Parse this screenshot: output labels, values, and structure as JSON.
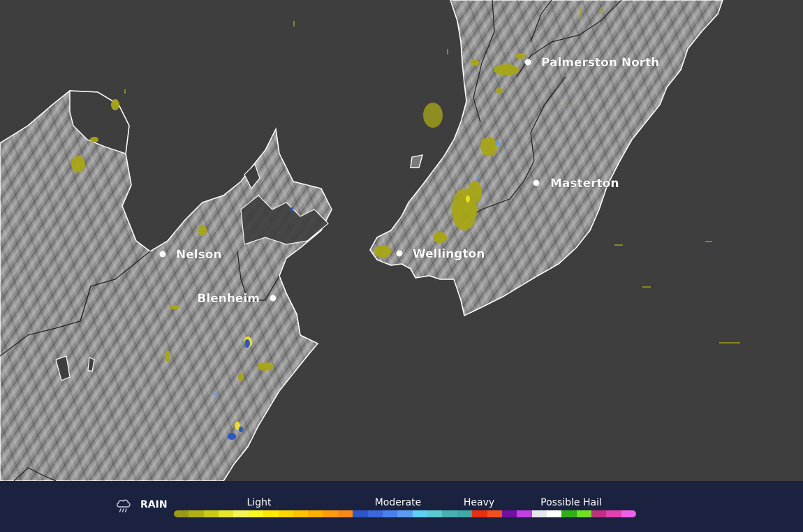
{
  "map": {
    "cities": [
      {
        "name": "Palmerston North"
      },
      {
        "name": "Masterton"
      },
      {
        "name": "Nelson"
      },
      {
        "name": "Wellington"
      },
      {
        "name": "Blenheim"
      }
    ]
  },
  "legend": {
    "icon": "rain-cloud-icon",
    "title": "RAIN",
    "labels": {
      "light": "Light",
      "moderate": "Moderate",
      "heavy": "Heavy",
      "hail": "Possible Hail"
    },
    "swatches": [
      "#9a9a12",
      "#b0b012",
      "#caca14",
      "#e6e628",
      "#f4f454",
      "#f8f820",
      "#fce800",
      "#fcd600",
      "#fcc400",
      "#fcb000",
      "#fb9c0a",
      "#f88a14",
      "#2d56c8",
      "#3c68dc",
      "#4a80ec",
      "#5a9cf2",
      "#5ed0f0",
      "#5cc8d0",
      "#48b0b0",
      "#40a8a8",
      "#e83010",
      "#f05020",
      "#7010a0",
      "#c040e0",
      "#e6e6ec",
      "#ffffff",
      "#30b018",
      "#70e020",
      "#c03080",
      "#e040b0",
      "#f060e8"
    ]
  }
}
